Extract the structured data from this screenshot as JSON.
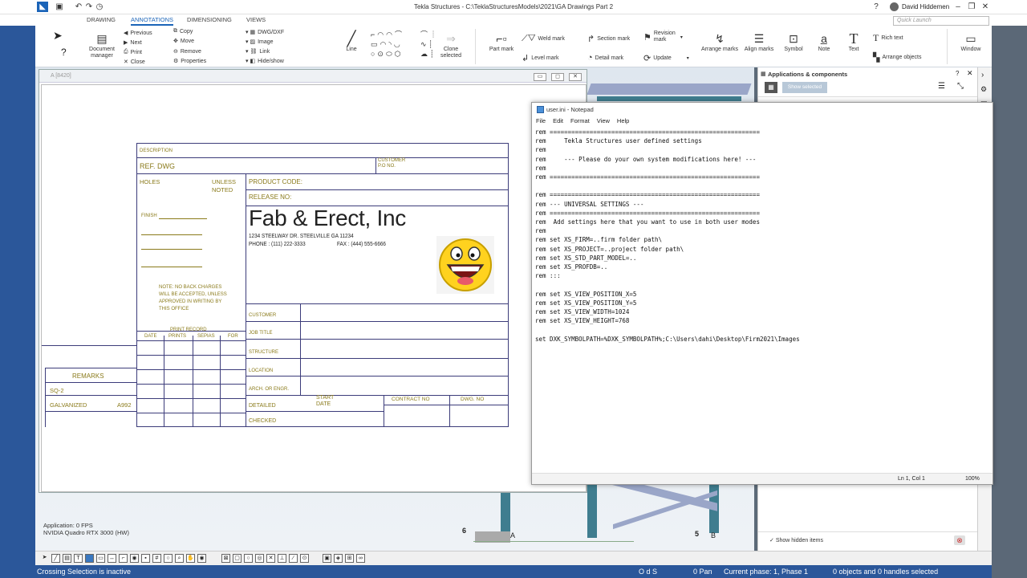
{
  "window": {
    "title": "Tekla Structures - C:\\TeklaStructuresModels\\2021\\GA Drawings Part 2",
    "user": "David Hiddemen",
    "quick_launch_placeholder": "Quick Launch"
  },
  "tabs": [
    "DRAWING",
    "ANNOTATIONS",
    "DIMENSIONING",
    "VIEWS"
  ],
  "active_tab": "ANNOTATIONS",
  "ribbon": {
    "document_manager": "Document manager",
    "previous": "Previous",
    "next": "Next",
    "print": "Print",
    "close": "Close",
    "copy": "Copy",
    "move": "Move",
    "remove": "Remove",
    "properties": "Properties",
    "dwg_dxf": "DWG/DXF",
    "image": "Image",
    "link": "Link",
    "hide_show": "Hide/show",
    "line": "Line",
    "clone_selected": "Clone selected",
    "part_mark": "Part mark",
    "weld_mark": "Weld mark",
    "level_mark": "Level mark",
    "section_mark": "Section mark",
    "detail_mark": "Detail mark",
    "revision_mark": "Revision mark",
    "update": "Update",
    "arrange_marks": "Arrange marks",
    "align_marks": "Align marks",
    "symbol": "Symbol",
    "note": "Note",
    "text": "Text",
    "rich_text": "Rich text",
    "arrange_objects": "Arrange objects",
    "window_btn": "Window"
  },
  "drawing_window": {
    "title": "A   [8420]"
  },
  "title_block": {
    "description_label": "DESCRIPTION",
    "ref_dwg": "REF. DWG",
    "customer_po": "CUSTOMER\nP.O NO.",
    "holes": "HOLES",
    "unless_noted": "UNLESS\nNOTED",
    "product_code": "PRODUCT CODE:",
    "release_no": "RELEASE NO:",
    "company_name": "Fab & Erect, Inc",
    "address": "1234 STEELWAY DR. STEELVILLE GA 11234",
    "phone": "PHONE : (111) 222-3333",
    "fax": "FAX : (444) 555-6666",
    "finish": "FINISH",
    "note_text": "NOTE: NO BACK CHARGES\nWILL BE ACCEPTED, UNLESS\nAPPROVED IN WRITING BY\nTHIS OFFICE",
    "print_record": "PRINT RECORD",
    "pr_cols": [
      "DATE",
      "PRINTS",
      "SEPIAS",
      "FOR"
    ],
    "customer": "CUSTOMER",
    "job_title": "JOB TITLE",
    "structure": "STRUCTURE",
    "location": "LOCATION",
    "arch_engr": "ARCH. OR ENGR.",
    "detailed": "DETAILED",
    "start_date": "START\nDATE",
    "contract_no": "CONTRACT NO",
    "dwg_no": "DWG. NO",
    "checked": "CHECKED",
    "remarks": "REMARKS",
    "sq": "SQ-2",
    "galvanized": "GALVANIZED",
    "a992": "A992"
  },
  "notepad": {
    "title": "user.ini - Notepad",
    "menu": [
      "File",
      "Edit",
      "Format",
      "View",
      "Help"
    ],
    "content": "rem ==========================================================\nrem     Tekla Structures user defined settings\nrem\nrem     --- Please do your own system modifications here! ---\nrem\nrem ==========================================================\n\nrem ==========================================================\nrem --- UNIVERSAL SETTINGS ---\nrem ==========================================================\nrem  Add settings here that you want to use in both user modes\nrem\nrem set XS_FIRM=..firm folder path\\\nrem set XS_PROJECT=..project folder path\\\nrem set XS_STD_PART_MODEL=..\nrem set XS_PROFDB=..\nrem :::\n\nrem set XS_VIEW_POSITION_X=5\nrem set XS_VIEW_POSITION_Y=5\nrem set XS_VIEW_WIDTH=1024\nrem set XS_VIEW_HEIGHT=768\n\nset DXK_SYMBOLPATH=%DXK_SYMBOLPATH%;C:\\Users\\dahi\\Desktop\\Firm2021\\Images",
    "cursor": "Ln 1, Col 1",
    "zoom": "100%"
  },
  "right_panel": {
    "title": "Applications & components",
    "show_selected": "Show selected",
    "show_hidden": "Show hidden items"
  },
  "viewport": {
    "fps": "Application: 0 FPS",
    "gpu": "NVIDIA Quadro RTX 3000 (HW)",
    "grid_labels": [
      "6",
      "A",
      "5",
      "B"
    ]
  },
  "status": {
    "message": "Crossing Selection is inactive",
    "ods": "O d S",
    "pan": "0 Pan",
    "phase": "Current phase: 1, Phase 1",
    "selection": "0 objects and 0 handles selected"
  }
}
